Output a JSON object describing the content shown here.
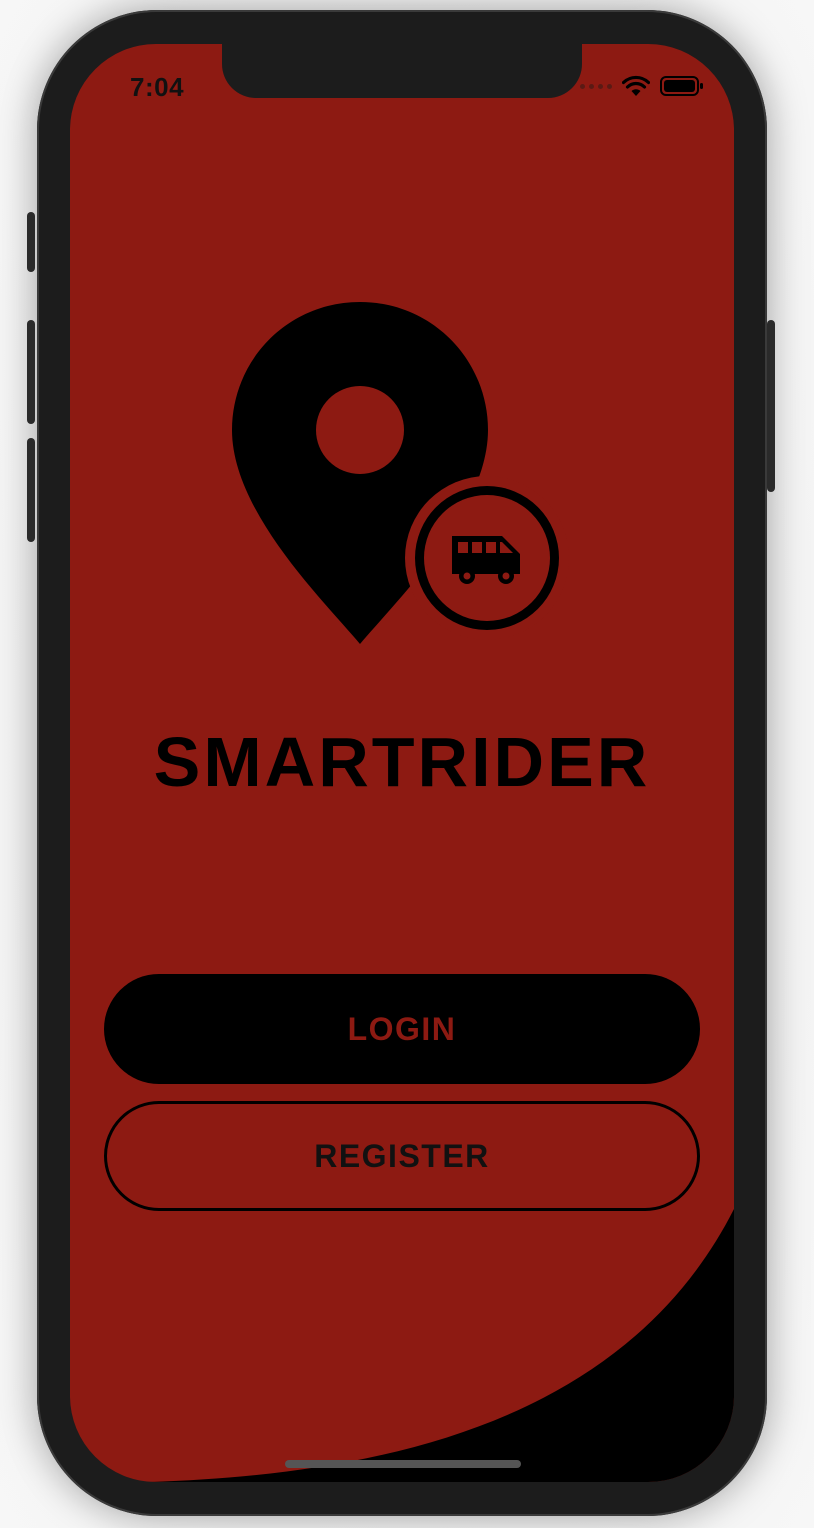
{
  "status_bar": {
    "time": "7:04",
    "icons": [
      "cellular-dots-icon",
      "wifi-icon",
      "battery-icon"
    ]
  },
  "app": {
    "logo_icon": "map-pin-with-bus-icon",
    "title": "SMARTRIDER"
  },
  "actions": {
    "login_label": "LOGIN",
    "register_label": "REGISTER"
  },
  "colors": {
    "background": "#8d1a12",
    "primary": "#000000",
    "frame": "#1c1c1c"
  }
}
